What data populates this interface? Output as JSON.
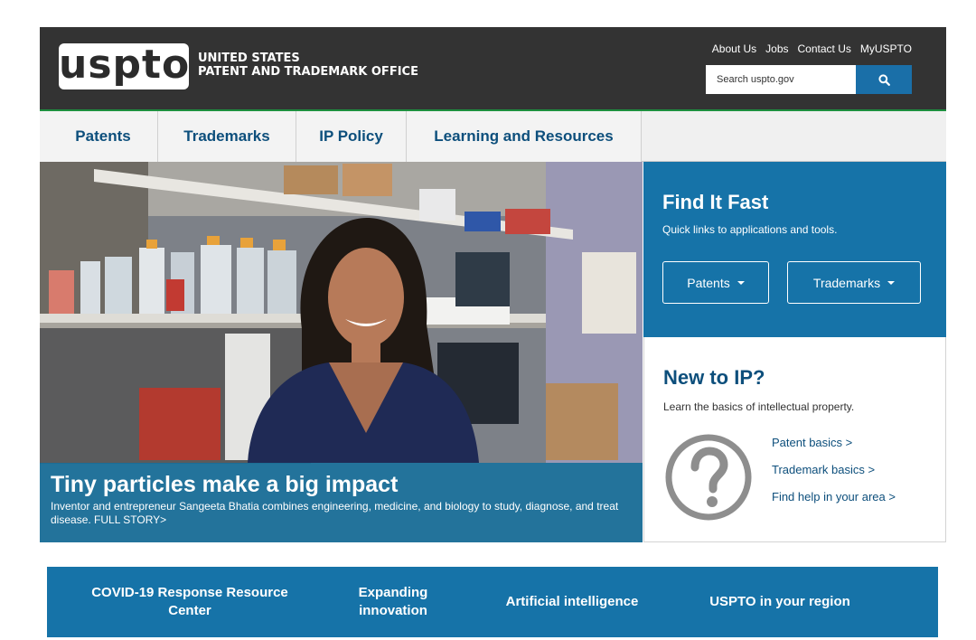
{
  "header": {
    "logo_text": "uspto",
    "office_line1": "UNITED STATES",
    "office_line2": "PATENT AND TRADEMARK OFFICE",
    "utility_links": [
      "About Us",
      "Jobs",
      "Contact Us",
      "MyUSPTO"
    ],
    "search_placeholder": "Search uspto.gov",
    "search_icon": "search-icon"
  },
  "nav": {
    "items": [
      "Patents",
      "Trademarks",
      "IP Policy",
      "Learning and Resources"
    ]
  },
  "hero": {
    "title": "Tiny particles make a big impact",
    "description": "Inventor and entrepreneur Sangeeta Bhatia combines engineering, medicine, and biology to study, diagnose, and treat disease. FULL STORY>"
  },
  "find_it_fast": {
    "title": "Find It Fast",
    "subtitle": "Quick links to applications and tools.",
    "buttons": [
      "Patents",
      "Trademarks"
    ]
  },
  "new_to_ip": {
    "title": "New to IP?",
    "subtitle": "Learn the basics of intellectual property.",
    "icon": "question-icon",
    "links": [
      "Patent basics >",
      "Trademark basics >",
      "Find help in your area >"
    ]
  },
  "bottom_band": {
    "items": [
      "COVID-19 Response Resource Center",
      "Expanding innovation",
      "Artificial intelligence",
      "USPTO in your region"
    ]
  },
  "colors": {
    "header_bg": "#333333",
    "accent_blue": "#1673a8",
    "nav_text": "#0d4f7c",
    "nav_bg": "#f3f3f3"
  }
}
